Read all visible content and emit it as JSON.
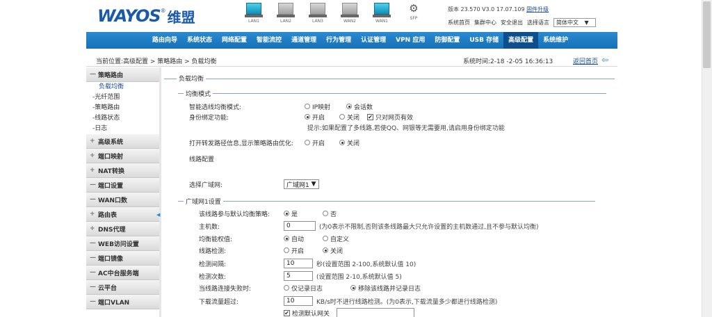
{
  "header": {
    "logo_text": "WAYOS",
    "logo_cn": "维盟",
    "logo_mark": "®",
    "version_text": "版本 23.570 V3.0 17.07.109",
    "upgrade_link": "固件升级",
    "links": [
      "系统首页",
      "集群中心",
      "安全退出",
      "选择语言"
    ],
    "language": "简体中文",
    "ports": [
      {
        "label": "LAN1",
        "active": true
      },
      {
        "label": "LAN2",
        "active": false
      },
      {
        "label": "LAN3",
        "active": false
      },
      {
        "label": "WAN2",
        "active": false
      },
      {
        "label": "WAN1",
        "active": true
      },
      {
        "label": "SFP",
        "active": false
      }
    ]
  },
  "nav": {
    "items": [
      "路由向导",
      "系统状态",
      "网络配置",
      "智能流控",
      "通道管理",
      "行为管理",
      "认证管理",
      "VPN 应用",
      "防御配置",
      "USB 存储",
      "高级配置",
      "系统维护"
    ],
    "active_index": 10
  },
  "breadcrumb": {
    "text": "当前位置:高级配置 > 策略路由 > 负载均衡",
    "system_time": "系统时间:2-18 -2-05 16:36:13",
    "back_link": "返回首页"
  },
  "sidebar": {
    "groups": [
      {
        "label": "策略路由",
        "sign": "—",
        "subs": [
          "负载均衡",
          "-光纤范围",
          "-策略路由",
          "-线路状态",
          "-日志"
        ]
      },
      {
        "label": "高级系统",
        "sign": "+"
      },
      {
        "label": "端口映射",
        "sign": "+"
      },
      {
        "label": "NAT转换",
        "sign": "+"
      },
      {
        "label": "端口设置",
        "sign": "—"
      },
      {
        "label": "WAN口数",
        "sign": "—"
      },
      {
        "label": "路由表",
        "sign": "+"
      },
      {
        "label": "DNS代理",
        "sign": "+"
      },
      {
        "label": "WEB访问设置",
        "sign": "—"
      },
      {
        "label": "端口镜像",
        "sign": "—"
      },
      {
        "label": "AC中台服务端",
        "sign": "—"
      },
      {
        "label": "云平台",
        "sign": "—"
      },
      {
        "label": "端口VLAN",
        "sign": "—"
      }
    ]
  },
  "content": {
    "outer_title": "负载均衡",
    "mode_title": "均衡模式",
    "smart_label": "智能选线均衡模式:",
    "smart_opts": [
      "IP映射",
      "会话数"
    ],
    "identity_label": "身份绑定功能:",
    "identity_opts": [
      "开启",
      "关闭"
    ],
    "identity_check": "只对网页有效",
    "identity_hint": "提示:如果配置了多线路,若使QQ、网银等无需要用,请启用身份绑定功能",
    "backup_label": "打开转发路径信息,显示策略路由优化:",
    "backup_opts": [
      "开启",
      "关闭"
    ],
    "line_config": "线路配置",
    "select_label": "选择广域网:",
    "select_value": "广域网1",
    "wan_title": "广域网1设置",
    "row_join": "该线路参与默认均衡策略:",
    "row_join_opts": [
      "是",
      "否"
    ],
    "row_hosts": "主机数:",
    "row_hosts_value": "0",
    "row_hosts_hint": "(为0表示不限制,否则该条线路最大只允许设置的主机数通过,且不参与默认均衡)",
    "row_weight": "均衡能权值:",
    "row_weight_opts": [
      "自动",
      "自定义"
    ],
    "row_detect": "线路检测:",
    "row_detect_opts": [
      "开启",
      "关闭"
    ],
    "row_interval": "检测间隔:",
    "row_interval_value": "10",
    "row_interval_hint": "秒(设置范围 2-100,系统默认值 10)",
    "row_count": "检测次数:",
    "row_count_value": "5",
    "row_count_hint": "(设置范围 2-10,系统默认值 5)",
    "row_fail": "当线路连接失败时:",
    "row_fail_opts": [
      "仅记录日志",
      "移除该线路并记录日志"
    ],
    "row_flow": "下载流量超过:",
    "row_flow_value": "10",
    "row_flow_hint": "KB/s时不进行线路检测。(为0表示,下载流量多少都进行线路检测)",
    "row_check": "检测默认网关"
  }
}
